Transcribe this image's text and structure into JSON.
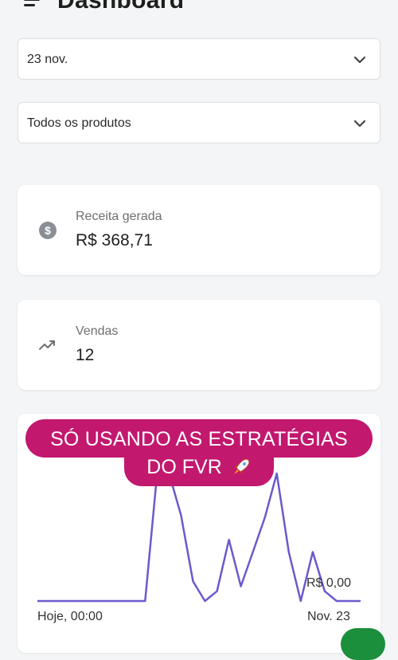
{
  "header": {
    "title": "Dashboard",
    "menu_icon": "menu-icon"
  },
  "filters": {
    "date": {
      "value": "23 nov.",
      "icon": "chevron-down-icon"
    },
    "product": {
      "value": "Todos os produtos",
      "icon": "chevron-down-icon"
    }
  },
  "cards": {
    "revenue": {
      "label": "Receita gerada",
      "value": "R$ 368,71",
      "icon": "dollar-coin-icon"
    },
    "sales": {
      "label": "Vendas",
      "value": "12",
      "icon": "trending-up-icon"
    }
  },
  "overlay": {
    "line1": "SÓ USANDO AS ESTRATÉGIAS",
    "line2": "DO FVR",
    "emoji": "rocket-icon",
    "color": "#c2186e"
  },
  "chart_data": {
    "type": "line",
    "series_color": "#6a5acd",
    "y_axis_label": "R$ 0,00",
    "x_start_label": "Hoje, 00:00",
    "x_end_label": "Nov. 23",
    "values": [
      0,
      0,
      0,
      0,
      0,
      0,
      0,
      0,
      0,
      0,
      0.52,
      0.52,
      0.35,
      0.08,
      0,
      0.04,
      0.25,
      0.06,
      0.2,
      0.34,
      0.52,
      0.2,
      0,
      0.2,
      0.04,
      0,
      0,
      0
    ]
  }
}
